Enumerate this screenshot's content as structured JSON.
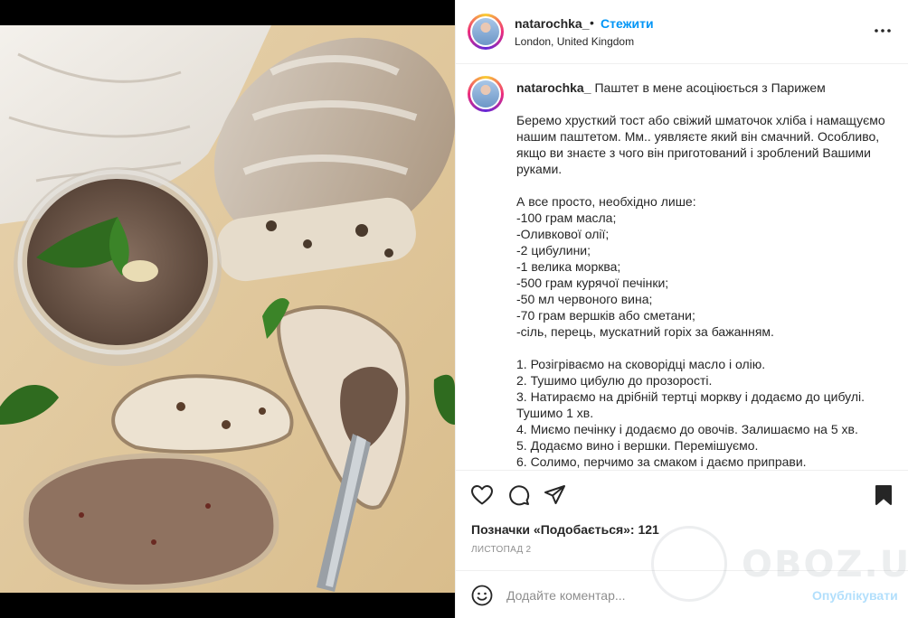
{
  "post": {
    "username": "natarochka_",
    "dot": "•",
    "follow_label": "Стежити",
    "location": "London, United Kingdom",
    "more_icon": "more-horizontal-icon"
  },
  "caption": {
    "username": "natarochka_",
    "title": "Паштет в мене асоціюється з Парижем",
    "body": "Беремо хрусткий тост або свіжий шматочок хліба і намащуємо нашим паштетом. Мм.. уявляєте який він смачний. Особливо, якщо ви знаєте з чого він приготований і зроблений Вашими руками.\n\nА все просто, необхідно лише:\n-100 грам масла;\n-Оливкової олії;\n-2 цибулини;\n-1 велика морква;\n-500 грам курячої печінки;\n-50 мл червоного вина;\n-70 грам вершків або сметани;\n-сіль, перець, мускатний горіх за бажанням.\n\n1. Розігріваємо на сковорідці масло і олію.\n2. Тушимо цибулю до прозорості.\n3. Натираємо на дрібній тертці моркву і додаємо до цибулі. Тушимо 1 хв.\n4. Миємо печінку і додаємо до овочів. Залишаємо на 5 хв.\n5. Додаємо вино і вершки. Перемішуємо.\n6. Солимо, перчимо за смаком і даємо приправи."
  },
  "actions": {
    "icons": [
      "heart-icon",
      "comment-icon",
      "share-icon",
      "bookmark-icon"
    ],
    "likes_text": "Позначки «Подобається»: 121",
    "date": "ЛИСТОПАД 2"
  },
  "comment": {
    "placeholder": "Додайте коментар...",
    "publish_label": "Опублікувати"
  },
  "watermark": {
    "text": "OBOZ.UA"
  },
  "colors": {
    "accent": "#0095f6",
    "publish_disabled": "#b2dffc",
    "text": "#262626",
    "muted": "#8e8e8e",
    "divider": "#efefef"
  }
}
